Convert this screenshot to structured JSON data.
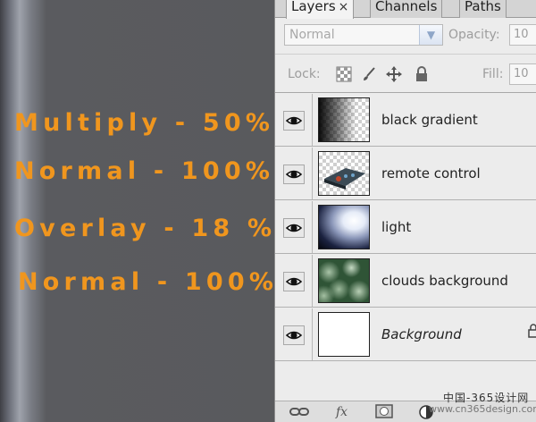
{
  "annotations": [
    {
      "text": "Multiply - 50%"
    },
    {
      "text": "Normal - 100%"
    },
    {
      "text": "Overlay - 18 %"
    },
    {
      "text": "Normal - 100%"
    }
  ],
  "annotation_color": "#f0961e",
  "tabs": [
    {
      "label": "Layers",
      "active": true,
      "close": "×"
    },
    {
      "label": "Channels",
      "active": false
    },
    {
      "label": "Paths",
      "active": false
    }
  ],
  "blend_mode": {
    "value": "Normal",
    "placeholder": ""
  },
  "opacity": {
    "label": "Opacity:",
    "value": "10"
  },
  "lock": {
    "label": "Lock:"
  },
  "fill": {
    "label": "Fill:",
    "value": "10"
  },
  "layers": [
    {
      "name": "black gradient",
      "thumbnail": "gradient-icon",
      "visible": true
    },
    {
      "name": "remote control",
      "thumbnail": "remote-icon",
      "visible": true
    },
    {
      "name": "light",
      "thumbnail": "light-icon",
      "visible": true
    },
    {
      "name": "clouds background",
      "thumbnail": "clouds-icon",
      "visible": true
    },
    {
      "name": "Background",
      "thumbnail": "blank-icon",
      "visible": true,
      "locked": true
    }
  ],
  "watermark": {
    "line1": "中国-365设计网",
    "line2": "www.cn365design.com"
  }
}
